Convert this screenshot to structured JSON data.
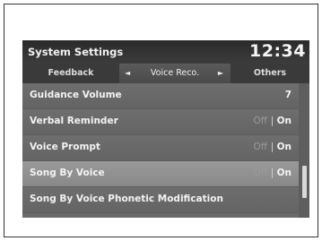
{
  "window": {
    "title": "System Settings",
    "clock": "12:34"
  },
  "tabs": [
    {
      "label": "Feedback"
    },
    {
      "label": "Voice Reco."
    },
    {
      "label": "Others"
    }
  ],
  "icons": {
    "left_arrow": "◄",
    "right_arrow": "►"
  },
  "list": {
    "items": [
      {
        "label": "Guidance Volume",
        "value": "7"
      },
      {
        "label": "Verbal Reminder",
        "off": "Off",
        "separator": "|",
        "on": "On"
      },
      {
        "label": "Voice Prompt",
        "off": "Off",
        "separator": "|",
        "on": "On"
      },
      {
        "label": "Song By Voice",
        "off": "Off",
        "separator": "|",
        "on": "On"
      },
      {
        "label": "Song By Voice Phonetic Modification"
      }
    ],
    "selected_index": 3
  }
}
